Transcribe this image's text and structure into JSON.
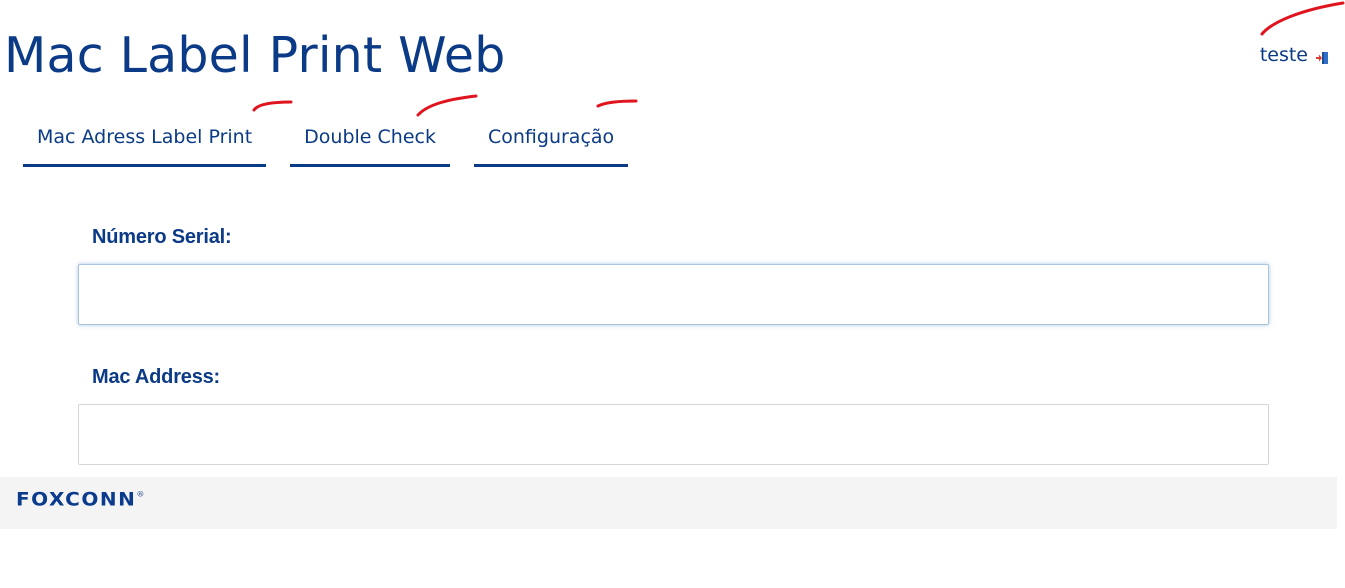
{
  "app_title": "Mac Label Print Web",
  "user": {
    "name": "teste",
    "logout_icon": "logout-door-icon"
  },
  "tabs": [
    {
      "label": "Mac Adress Label Print"
    },
    {
      "label": "Double Check"
    },
    {
      "label": "Configuração"
    }
  ],
  "form": {
    "serial": {
      "label": "Número Serial:",
      "value": ""
    },
    "mac": {
      "label": "Mac Address:",
      "value": ""
    }
  },
  "footer": {
    "logo_text": "FOXCONN",
    "logo_mark": "®"
  },
  "colors": {
    "primary": "#0b3a86",
    "footer_bg": "#f4f4f4",
    "annotation": "#e0141e"
  }
}
